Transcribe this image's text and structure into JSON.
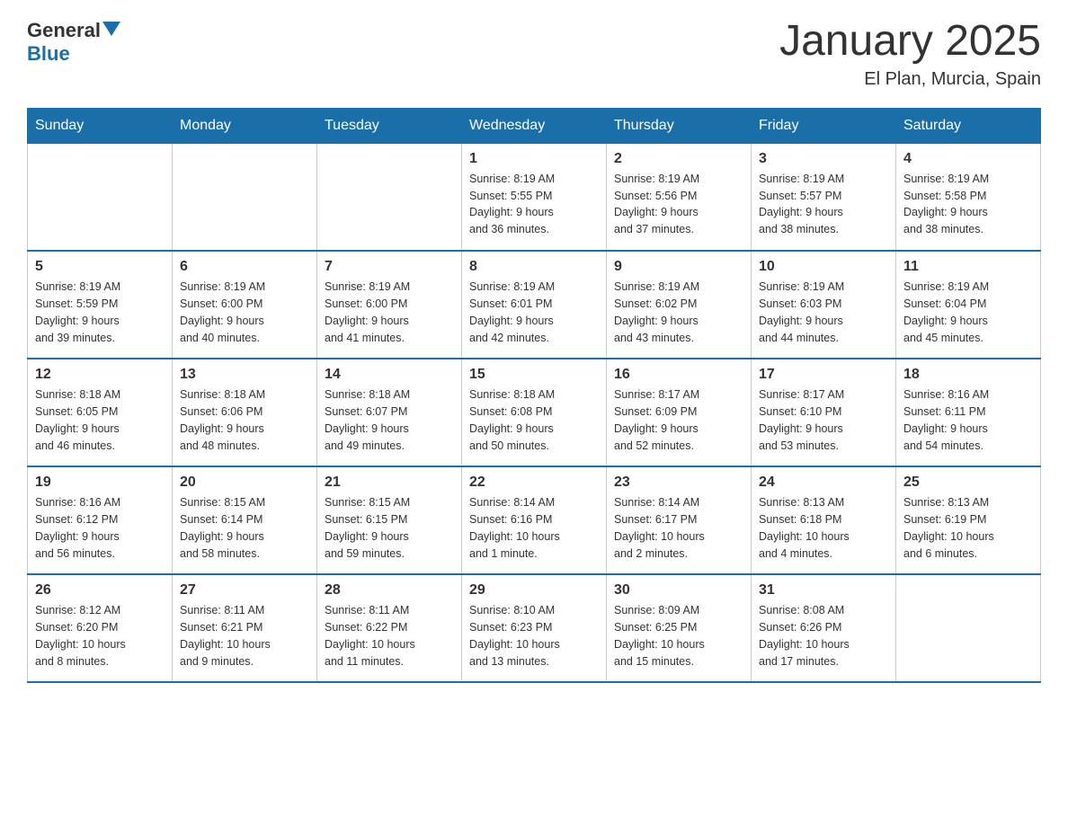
{
  "header": {
    "logo_general": "General",
    "logo_blue": "Blue",
    "month": "January 2025",
    "location": "El Plan, Murcia, Spain"
  },
  "days_of_week": [
    "Sunday",
    "Monday",
    "Tuesday",
    "Wednesday",
    "Thursday",
    "Friday",
    "Saturday"
  ],
  "weeks": [
    [
      {
        "day": "",
        "info": ""
      },
      {
        "day": "",
        "info": ""
      },
      {
        "day": "",
        "info": ""
      },
      {
        "day": "1",
        "info": "Sunrise: 8:19 AM\nSunset: 5:55 PM\nDaylight: 9 hours\nand 36 minutes."
      },
      {
        "day": "2",
        "info": "Sunrise: 8:19 AM\nSunset: 5:56 PM\nDaylight: 9 hours\nand 37 minutes."
      },
      {
        "day": "3",
        "info": "Sunrise: 8:19 AM\nSunset: 5:57 PM\nDaylight: 9 hours\nand 38 minutes."
      },
      {
        "day": "4",
        "info": "Sunrise: 8:19 AM\nSunset: 5:58 PM\nDaylight: 9 hours\nand 38 minutes."
      }
    ],
    [
      {
        "day": "5",
        "info": "Sunrise: 8:19 AM\nSunset: 5:59 PM\nDaylight: 9 hours\nand 39 minutes."
      },
      {
        "day": "6",
        "info": "Sunrise: 8:19 AM\nSunset: 6:00 PM\nDaylight: 9 hours\nand 40 minutes."
      },
      {
        "day": "7",
        "info": "Sunrise: 8:19 AM\nSunset: 6:00 PM\nDaylight: 9 hours\nand 41 minutes."
      },
      {
        "day": "8",
        "info": "Sunrise: 8:19 AM\nSunset: 6:01 PM\nDaylight: 9 hours\nand 42 minutes."
      },
      {
        "day": "9",
        "info": "Sunrise: 8:19 AM\nSunset: 6:02 PM\nDaylight: 9 hours\nand 43 minutes."
      },
      {
        "day": "10",
        "info": "Sunrise: 8:19 AM\nSunset: 6:03 PM\nDaylight: 9 hours\nand 44 minutes."
      },
      {
        "day": "11",
        "info": "Sunrise: 8:19 AM\nSunset: 6:04 PM\nDaylight: 9 hours\nand 45 minutes."
      }
    ],
    [
      {
        "day": "12",
        "info": "Sunrise: 8:18 AM\nSunset: 6:05 PM\nDaylight: 9 hours\nand 46 minutes."
      },
      {
        "day": "13",
        "info": "Sunrise: 8:18 AM\nSunset: 6:06 PM\nDaylight: 9 hours\nand 48 minutes."
      },
      {
        "day": "14",
        "info": "Sunrise: 8:18 AM\nSunset: 6:07 PM\nDaylight: 9 hours\nand 49 minutes."
      },
      {
        "day": "15",
        "info": "Sunrise: 8:18 AM\nSunset: 6:08 PM\nDaylight: 9 hours\nand 50 minutes."
      },
      {
        "day": "16",
        "info": "Sunrise: 8:17 AM\nSunset: 6:09 PM\nDaylight: 9 hours\nand 52 minutes."
      },
      {
        "day": "17",
        "info": "Sunrise: 8:17 AM\nSunset: 6:10 PM\nDaylight: 9 hours\nand 53 minutes."
      },
      {
        "day": "18",
        "info": "Sunrise: 8:16 AM\nSunset: 6:11 PM\nDaylight: 9 hours\nand 54 minutes."
      }
    ],
    [
      {
        "day": "19",
        "info": "Sunrise: 8:16 AM\nSunset: 6:12 PM\nDaylight: 9 hours\nand 56 minutes."
      },
      {
        "day": "20",
        "info": "Sunrise: 8:15 AM\nSunset: 6:14 PM\nDaylight: 9 hours\nand 58 minutes."
      },
      {
        "day": "21",
        "info": "Sunrise: 8:15 AM\nSunset: 6:15 PM\nDaylight: 9 hours\nand 59 minutes."
      },
      {
        "day": "22",
        "info": "Sunrise: 8:14 AM\nSunset: 6:16 PM\nDaylight: 10 hours\nand 1 minute."
      },
      {
        "day": "23",
        "info": "Sunrise: 8:14 AM\nSunset: 6:17 PM\nDaylight: 10 hours\nand 2 minutes."
      },
      {
        "day": "24",
        "info": "Sunrise: 8:13 AM\nSunset: 6:18 PM\nDaylight: 10 hours\nand 4 minutes."
      },
      {
        "day": "25",
        "info": "Sunrise: 8:13 AM\nSunset: 6:19 PM\nDaylight: 10 hours\nand 6 minutes."
      }
    ],
    [
      {
        "day": "26",
        "info": "Sunrise: 8:12 AM\nSunset: 6:20 PM\nDaylight: 10 hours\nand 8 minutes."
      },
      {
        "day": "27",
        "info": "Sunrise: 8:11 AM\nSunset: 6:21 PM\nDaylight: 10 hours\nand 9 minutes."
      },
      {
        "day": "28",
        "info": "Sunrise: 8:11 AM\nSunset: 6:22 PM\nDaylight: 10 hours\nand 11 minutes."
      },
      {
        "day": "29",
        "info": "Sunrise: 8:10 AM\nSunset: 6:23 PM\nDaylight: 10 hours\nand 13 minutes."
      },
      {
        "day": "30",
        "info": "Sunrise: 8:09 AM\nSunset: 6:25 PM\nDaylight: 10 hours\nand 15 minutes."
      },
      {
        "day": "31",
        "info": "Sunrise: 8:08 AM\nSunset: 6:26 PM\nDaylight: 10 hours\nand 17 minutes."
      },
      {
        "day": "",
        "info": ""
      }
    ]
  ]
}
